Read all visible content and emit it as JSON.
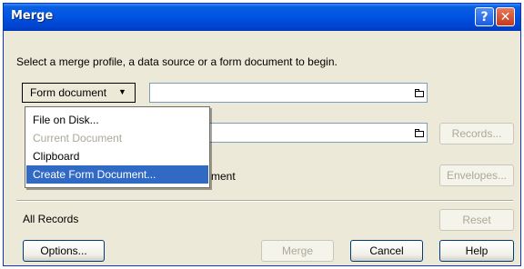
{
  "window": {
    "title": "Merge",
    "help_glyph": "?",
    "close_glyph": "✕"
  },
  "instructions": "Select a merge profile, a data source or a form document to begin.",
  "form_document_button": {
    "label": "Form document",
    "chevron": "▼"
  },
  "menu": {
    "items": [
      {
        "label": "File on Disk...",
        "state": "normal"
      },
      {
        "label": "Current Document",
        "state": "disabled"
      },
      {
        "label": "Clipboard",
        "state": "normal"
      },
      {
        "label": "Create Form Document...",
        "state": "selected"
      }
    ]
  },
  "form_document_path": "",
  "data_source_path": "",
  "partial_label": "ment",
  "records_button": "Records...",
  "envelopes_button": "Envelopes...",
  "all_records_label": "All Records",
  "reset_button": "Reset",
  "footer": {
    "options": "Options...",
    "merge": "Merge",
    "cancel": "Cancel",
    "help": "Help"
  }
}
